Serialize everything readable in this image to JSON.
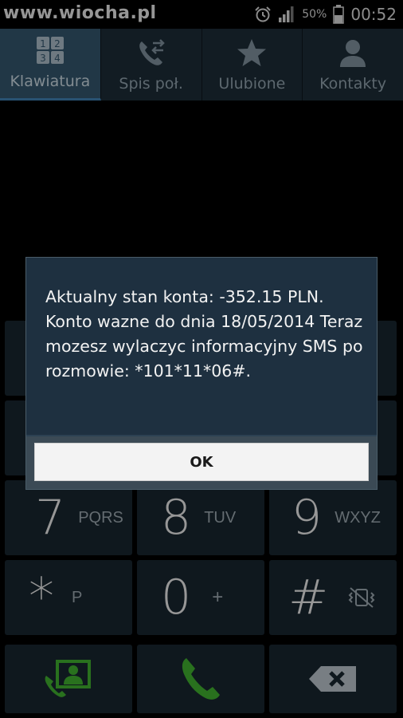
{
  "status_bar": {
    "watermark": "www.wiocha.pl",
    "battery_percent": "50%",
    "time": "00:52",
    "icons": [
      "alarm-icon",
      "signal-icon",
      "battery-icon"
    ]
  },
  "tabs": [
    {
      "label": "Klawiatura",
      "icon": "keypad-icon",
      "active": true
    },
    {
      "label": "Spis poł.",
      "icon": "call-log-icon",
      "active": false
    },
    {
      "label": "Ulubione",
      "icon": "star-icon",
      "active": false
    },
    {
      "label": "Kontakty",
      "icon": "person-icon",
      "active": false
    }
  ],
  "keypad": {
    "row3": [
      {
        "digit": "7",
        "letters": "PQRS"
      },
      {
        "digit": "8",
        "letters": "TUV"
      },
      {
        "digit": "9",
        "letters": "WXYZ"
      }
    ],
    "row4": [
      {
        "digit": "*",
        "letters": "P"
      },
      {
        "digit": "0",
        "letters": "+"
      },
      {
        "digit": "#",
        "letters": ""
      }
    ]
  },
  "dialog": {
    "message": "Aktualny stan konta: -352.15 PLN. Konto wazne do dnia 18/05/2014  Teraz mozesz wylaczyc informacyjny SMS po rozmowie: *101*11*06#.",
    "ok_label": "OK"
  },
  "colors": {
    "call_green": "#3fae2e",
    "tab_active": "#34556c",
    "dialog_bg": "#1e3040"
  }
}
